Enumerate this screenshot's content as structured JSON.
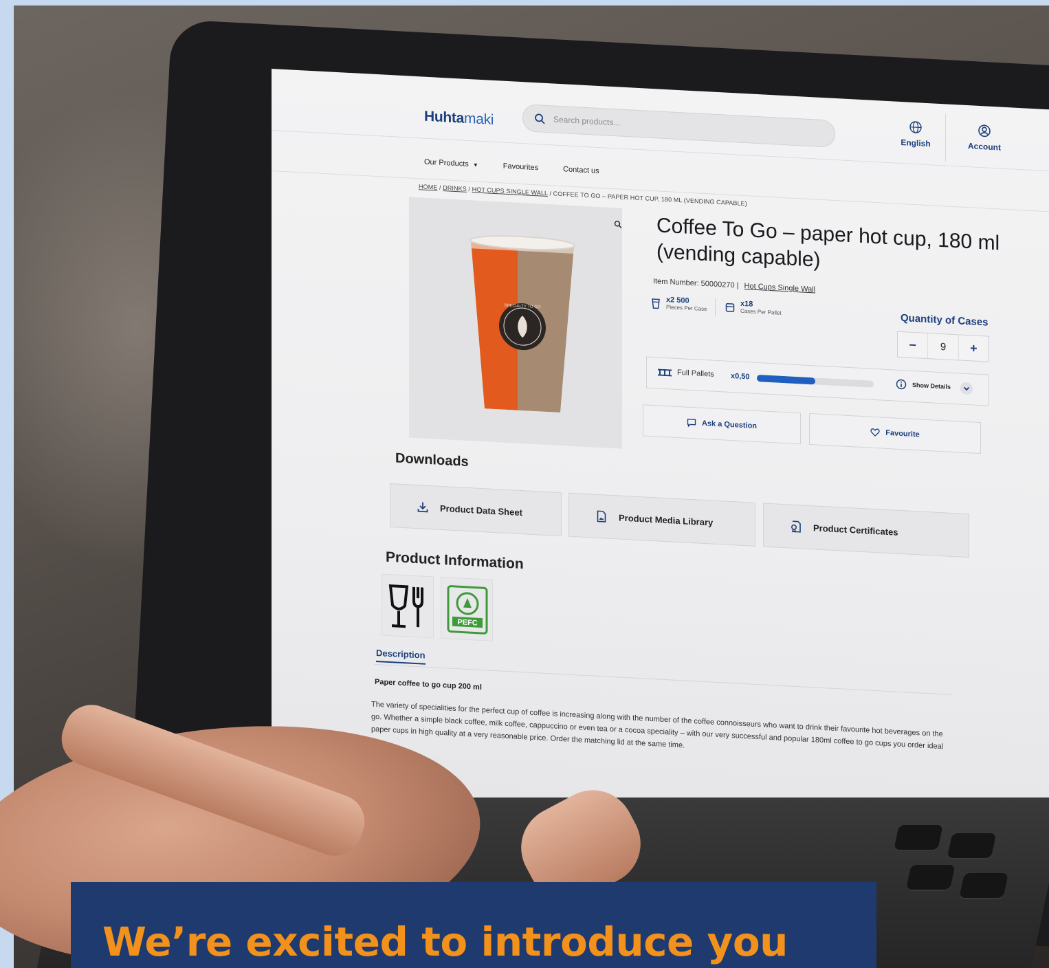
{
  "header": {
    "logo_strong": "Huhta",
    "logo_light": "maki",
    "search_placeholder": "Search products...",
    "language_label": "English",
    "account_label": "Account"
  },
  "nav": {
    "items": [
      "Our Products",
      "Favourites",
      "Contact us"
    ]
  },
  "breadcrumb": {
    "home": "HOME",
    "drinks": "DRINKS",
    "category": "HOT CUPS SINGLE WALL",
    "current": "COFFEE TO GO – PAPER HOT CUP, 180 ML (VENDING CAPABLE)",
    "separator": " / "
  },
  "product": {
    "title": "Coffee To Go – paper hot cup, 180 ml (vending capable)",
    "item_number": "Item Number: 50000270  |",
    "category_link": "Hot Cups Single Wall",
    "pieces_value": "x2 500",
    "pieces_label": "Pieces Per Case",
    "cases_value": "x18",
    "cases_label": "Cases Per Pallet",
    "quantity_label": "Quantity of Cases",
    "quantity_value": "9",
    "minus": "−",
    "plus": "+",
    "pallets_label": "Full Pallets",
    "pallets_amount": "x0,50",
    "pallets_fill": 0.5,
    "show_details": "Show Details",
    "ask_label": "Ask a Question",
    "favourite_label": "Favourite",
    "cup_text": "SPECIALTY TO GO"
  },
  "downloads": {
    "heading": "Downloads",
    "items": [
      "Product Data Sheet",
      "Product Media Library",
      "Product Certificates"
    ]
  },
  "info": {
    "heading": "Product Information",
    "pefc_text": "PEFC",
    "description_tab": "Description",
    "subtitle": "Paper coffee to go cup 200 ml",
    "body": "The variety of specialities for the perfect cup of coffee is increasing along with the number of the coffee connoisseurs who want to drink their favourite hot beverages on the go. Whether a simple black coffee, milk coffee, cappuccino or even tea or a cocoa speciality – with our very successful and popular 180ml coffee to go cups you order ideal paper cups in high quality at a very reasonable price. Order the matching lid at the same time."
  },
  "banner": {
    "headline": "We’re excited to introduce you"
  },
  "colors": {
    "brand_navy": "#1c3f7c",
    "banner_bg": "#1f3a6e",
    "banner_text": "#f2911b",
    "progress": "#1f5fc0",
    "cup_orange": "#e25a1e",
    "cup_brown": "#a78a72"
  }
}
